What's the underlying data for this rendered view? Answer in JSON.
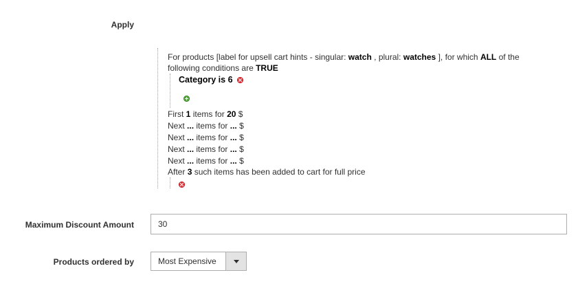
{
  "form": {
    "apply_label": "Apply",
    "max_discount_label": "Maximum Discount Amount",
    "max_discount_value": "30",
    "products_ordered_label": "Products ordered by",
    "products_ordered_value": "Most Expensive"
  },
  "rule": {
    "intro_text_1": "For products [label for upsell cart hints - singular:",
    "singular_value": "watch",
    "intro_text_2": ", plural:",
    "plural_value": "watches",
    "intro_text_3": "], for which",
    "aggregator_value": "ALL",
    "intro_text_4": "of the",
    "intro_line2_text": "following conditions are",
    "value_value": "TRUE",
    "condition": {
      "attribute": "Category",
      "operator": "is",
      "value": "6"
    },
    "tiers": [
      {
        "prefix": "First",
        "qty": "1",
        "mid": "items for",
        "price": "20",
        "suffix": "$"
      },
      {
        "prefix": "Next",
        "qty": "...",
        "mid": "items for",
        "price": "...",
        "suffix": "$"
      },
      {
        "prefix": "Next",
        "qty": "...",
        "mid": "items for",
        "price": "...",
        "suffix": "$"
      },
      {
        "prefix": "Next",
        "qty": "...",
        "mid": "items for",
        "price": "...",
        "suffix": "$"
      },
      {
        "prefix": "Next",
        "qty": "...",
        "mid": "items for",
        "price": "...",
        "suffix": "$"
      }
    ],
    "after_prefix": "After",
    "after_qty": "3",
    "after_suffix": "such items has been added to cart for full price"
  },
  "icons": {
    "remove": "remove-icon",
    "add": "add-icon",
    "dropdown": "chevron-down-icon"
  }
}
